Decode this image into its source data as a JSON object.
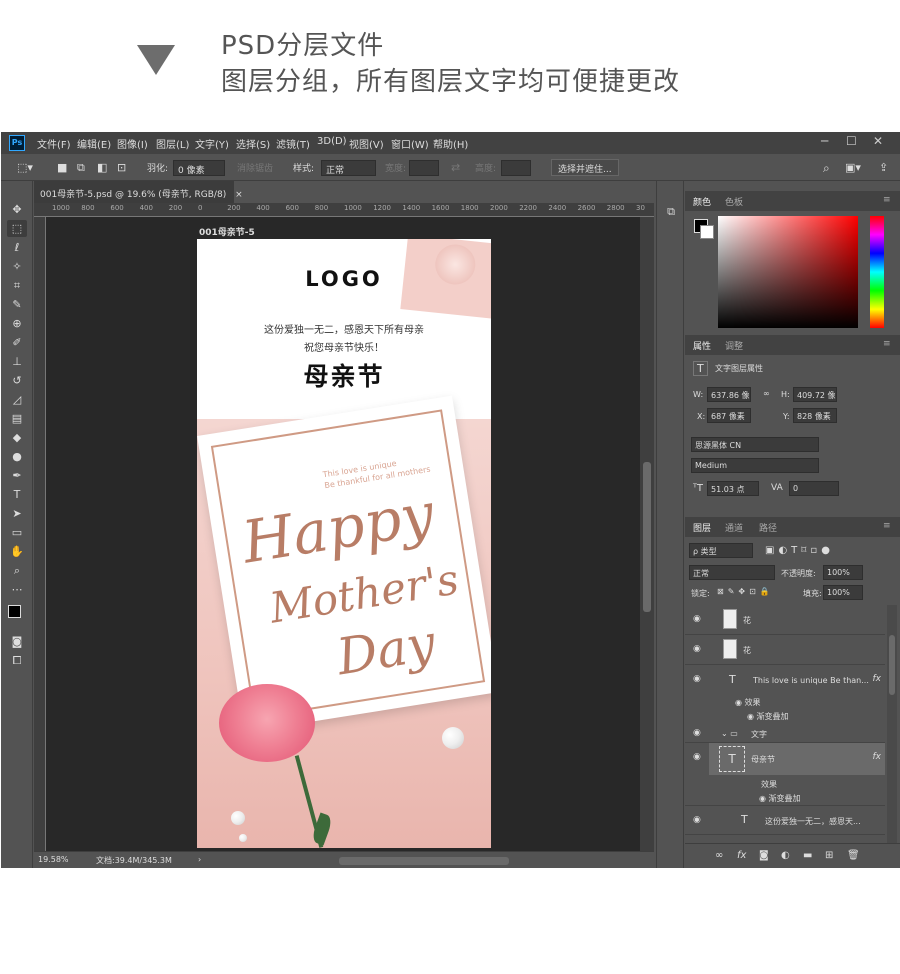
{
  "banner": {
    "line1": "PSD分层文件",
    "line2": "图层分组，所有图层文字均可便捷更改"
  },
  "menu": [
    "文件(F)",
    "编辑(E)",
    "图像(I)",
    "图层(L)",
    "文字(Y)",
    "选择(S)",
    "滤镜(T)",
    "3D(D)",
    "视图(V)",
    "窗口(W)",
    "帮助(H)"
  ],
  "app_logo": "Ps",
  "window_controls": [
    "─",
    "☐",
    "✕"
  ],
  "options": {
    "feather_label": "羽化:",
    "feather_value": "0 像素",
    "antialias_label": "消除锯齿",
    "style_label": "样式:",
    "style_value": "正常",
    "width_label": "宽度:",
    "height_label": "高度:",
    "select_mask_button": "选择并遮住..."
  },
  "document": {
    "tab_title": "001母亲节-5.psd @ 19.6% (母亲节, RGB/8)",
    "artboard_name": "001母亲节-5",
    "ruler_labels": [
      "1000",
      "800",
      "600",
      "400",
      "200",
      "0",
      "200",
      "400",
      "600",
      "800",
      "1000",
      "1200",
      "1400",
      "1600",
      "1800",
      "2000",
      "2200",
      "2400",
      "2600",
      "2800",
      "30"
    ],
    "zoom": "19.58%",
    "doc_size": "文档:39.4M/345.3M"
  },
  "artboard": {
    "logo": "LOGO",
    "line1": "这份爱独一无二，感恩天下所有母亲",
    "line2": "祝您母亲节快乐！",
    "title": "母亲节",
    "small1": "This love is unique",
    "small2": "Be thankful for all mothers",
    "script1": "Happy",
    "script2": "Mother's",
    "script3": "Day"
  },
  "color_panel": {
    "tab1": "颜色",
    "tab2": "色板"
  },
  "properties": {
    "tab1": "属性",
    "tab2": "调整",
    "kind": "文字图层属性",
    "w_label": "W:",
    "w_value": "637.86 像",
    "h_label": "H:",
    "h_value": "409.72 像",
    "x_label": "X:",
    "x_value": "687 像素",
    "y_label": "Y:",
    "y_value": "828 像素",
    "font": "思源黑体 CN",
    "weight": "Medium",
    "size": "51.03 点",
    "tracking": "0"
  },
  "layers_panel": {
    "tab1": "图层",
    "tab2": "通道",
    "tab3": "路径",
    "filter": "ρ 类型",
    "blend": "正常",
    "opacity_label": "不透明度:",
    "opacity": "100%",
    "lock_label": "锁定:",
    "fill_label": "填充:",
    "fill": "100%",
    "layers": [
      {
        "name": "花",
        "type": "image"
      },
      {
        "name": "花",
        "type": "image"
      },
      {
        "name": "This love is unique Be than...",
        "type": "text",
        "fx": "fx"
      },
      {
        "name": "效果",
        "type": "effect"
      },
      {
        "name": "渐变叠加",
        "type": "effect"
      },
      {
        "name": "文字",
        "type": "group"
      },
      {
        "name": "母亲节",
        "type": "text",
        "fx": "fx",
        "selected": true
      },
      {
        "name": "效果",
        "type": "effect"
      },
      {
        "name": "渐变叠加",
        "type": "effect"
      },
      {
        "name": "这份爱独一无二，感恩天...",
        "type": "text"
      }
    ]
  },
  "colors": {
    "accent": "#31a8ff",
    "dark": "#282828",
    "panel": "#535353"
  }
}
